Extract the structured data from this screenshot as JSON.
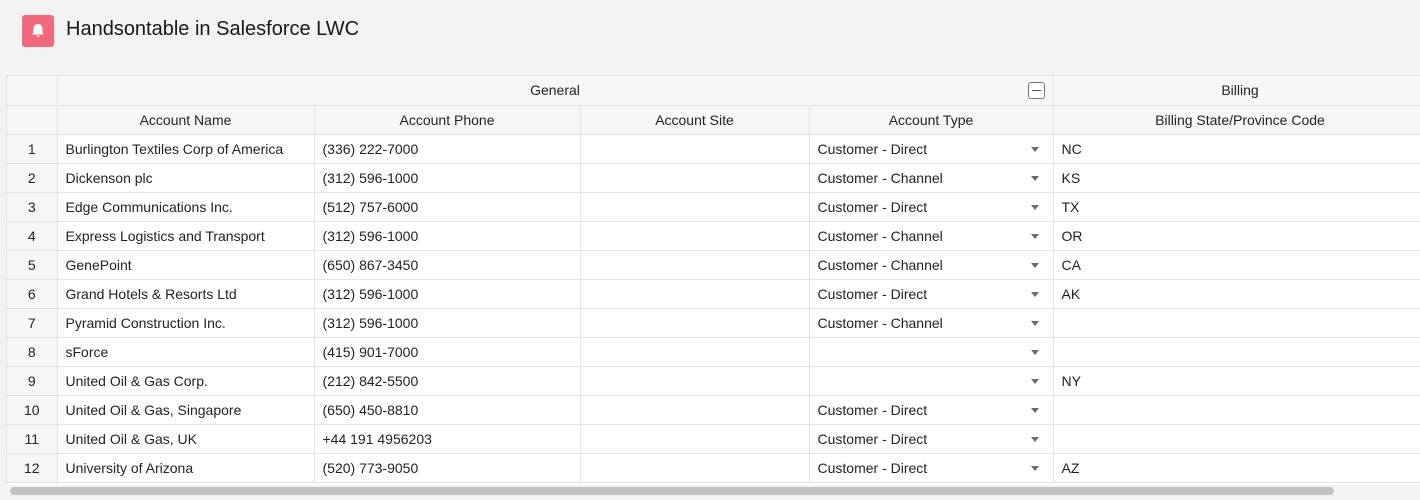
{
  "app": {
    "title": "Handsontable in Salesforce LWC",
    "icon": "bell-icon",
    "icon_color": "#f2697d"
  },
  "grid": {
    "groups": [
      {
        "label": "General",
        "collapse_icon": "minus-icon"
      },
      {
        "label": "Billing"
      }
    ],
    "columns": [
      "Account Name",
      "Account Phone",
      "Account Site",
      "Account Type",
      "Billing State/Province Code"
    ],
    "rows": [
      {
        "num": "1",
        "name": "Burlington Textiles Corp of America",
        "phone": "(336) 222-7000",
        "site": "",
        "type": "Customer - Direct",
        "state": "NC"
      },
      {
        "num": "2",
        "name": "Dickenson plc",
        "phone": "(312) 596-1000",
        "site": "",
        "type": "Customer - Channel",
        "state": "KS"
      },
      {
        "num": "3",
        "name": "Edge Communications Inc.",
        "phone": "(512) 757-6000",
        "site": "",
        "type": "Customer - Direct",
        "state": "TX"
      },
      {
        "num": "4",
        "name": "Express Logistics and Transport",
        "phone": "(312) 596-1000",
        "site": "",
        "type": "Customer - Channel",
        "state": "OR"
      },
      {
        "num": "5",
        "name": "GenePoint",
        "phone": "(650) 867-3450",
        "site": "",
        "type": "Customer - Channel",
        "state": "CA"
      },
      {
        "num": "6",
        "name": "Grand Hotels & Resorts Ltd",
        "phone": "(312) 596-1000",
        "site": "",
        "type": "Customer - Direct",
        "state": "AK"
      },
      {
        "num": "7",
        "name": "Pyramid Construction Inc.",
        "phone": "(312) 596-1000",
        "site": "",
        "type": "Customer - Channel",
        "state": ""
      },
      {
        "num": "8",
        "name": "sForce",
        "phone": "(415) 901-7000",
        "site": "",
        "type": "",
        "state": ""
      },
      {
        "num": "9",
        "name": "United Oil & Gas Corp.",
        "phone": "(212) 842-5500",
        "site": "",
        "type": "",
        "state": "NY"
      },
      {
        "num": "10",
        "name": "United Oil & Gas, Singapore",
        "phone": "(650) 450-8810",
        "site": "",
        "type": "Customer - Direct",
        "state": ""
      },
      {
        "num": "11",
        "name": "United Oil & Gas, UK",
        "phone": "+44 191 4956203",
        "site": "",
        "type": "Customer - Direct",
        "state": ""
      },
      {
        "num": "12",
        "name": "University of Arizona",
        "phone": "(520) 773-9050",
        "site": "",
        "type": "Customer - Direct",
        "state": "AZ"
      }
    ]
  }
}
